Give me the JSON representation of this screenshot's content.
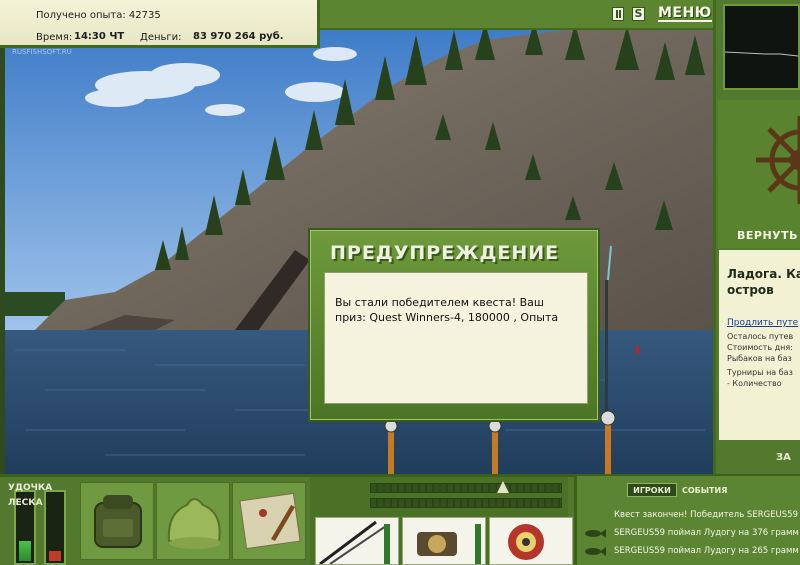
{
  "stats": {
    "experience": "Получено опыта: 42735",
    "time_label": "Время:",
    "time_value": "14:30 ЧТ",
    "money_label": "Деньги:",
    "money_value": "83 970 264 руб."
  },
  "watermark": "RUSFISHSOFT.RU",
  "top_controls": {
    "sound_glyph": "S",
    "menu_label": "МЕНЮ"
  },
  "right_panel": {
    "return_label": "ВЕРНУТЬ",
    "location_title": "Ладога. Ка остров",
    "extend_link": "Продлить путе",
    "info_lines": [
      "Осталось путев",
      "Стоимость дня:",
      "Рыбаков на баз",
      "Турниры на баз",
      "- Количество"
    ],
    "bottom_label": "ЗА"
  },
  "dialog": {
    "title": "ПРЕДУПРЕЖДЕНИЕ",
    "message": "Вы стали победителем квеста! Ваш приз: Quest Winners-4, 180000 , Опыта"
  },
  "rod_panel": {
    "rod_label": "УДОЧКА",
    "line_label": "ЛЕСКА"
  },
  "events_panel": {
    "tab_players": "ИГРОКИ",
    "tab_events": "СОБЫТИЯ",
    "rows": [
      "Квест закончен! Победитель SERGEUS59",
      "SERGEUS59 поймал Лудогу на 376 грамм",
      "SERGEUS59 поймал Лудогу на 265 грамм"
    ]
  },
  "colors": {
    "panel_green": "#52792d",
    "dark_green": "#3c6019",
    "paper": "#f5f3de",
    "water": "#2f5a8a",
    "sky": "#5d93d0"
  },
  "icons": [
    "pause-icon",
    "sound-icon",
    "helm-wheel-icon",
    "backpack-icon",
    "bag-icon",
    "map-icon",
    "rod-icon",
    "reel-icon",
    "line-spool-icon",
    "fish-icon"
  ]
}
